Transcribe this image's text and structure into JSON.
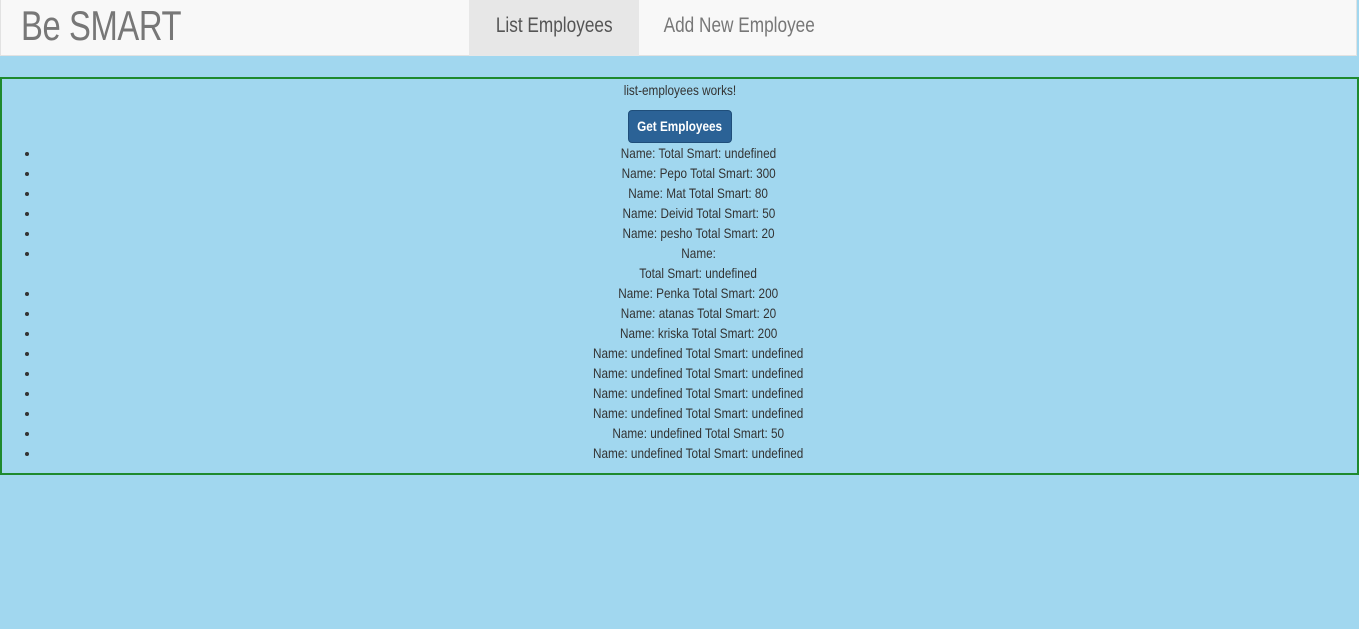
{
  "navbar": {
    "brand": "Be SMART",
    "tabs": [
      {
        "label": "List Employees",
        "active": true
      },
      {
        "label": "Add New Employee",
        "active": false
      }
    ]
  },
  "main": {
    "status_text": "list-employees works!",
    "get_button_label": "Get Employees",
    "employees": [
      [
        "Name: Total Smart: undefined"
      ],
      [
        "Name: Pepo Total Smart: 300"
      ],
      [
        "Name: Mat Total Smart: 80"
      ],
      [
        "Name: Deivid Total Smart: 50"
      ],
      [
        "Name: pesho Total Smart: 20"
      ],
      [
        "Name:",
        "Total Smart: undefined"
      ],
      [
        "Name: Penka Total Smart: 200"
      ],
      [
        "Name: atanas Total Smart: 20"
      ],
      [
        "Name: kriska Total Smart: 200"
      ],
      [
        "Name: undefined Total Smart: undefined"
      ],
      [
        "Name: undefined Total Smart: undefined"
      ],
      [
        "Name: undefined Total Smart: undefined"
      ],
      [
        "Name: undefined Total Smart: undefined"
      ],
      [
        "Name: undefined Total Smart: 50"
      ],
      [
        "Name: undefined Total Smart: undefined"
      ]
    ]
  },
  "colors": {
    "background": "#a1d7ef",
    "navbar": "#f8f8f8",
    "active_tab": "#e7e7e7",
    "panel_border": "#1e8a2e",
    "button": "#2b6296"
  }
}
